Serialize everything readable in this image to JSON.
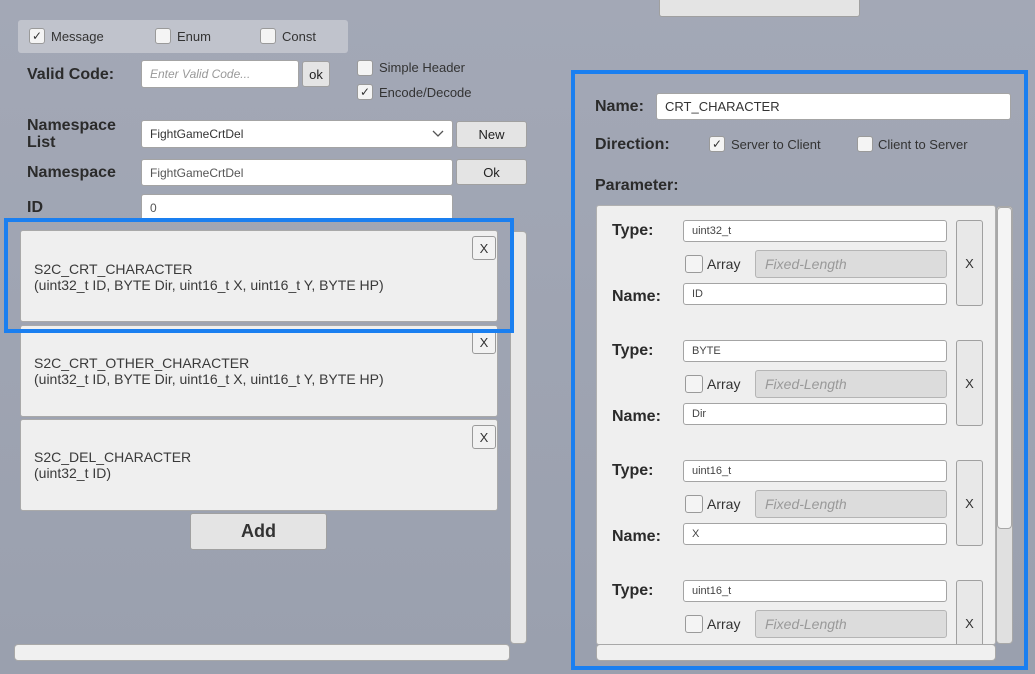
{
  "top_button": {
    "label": ""
  },
  "options": [
    {
      "label": "Message",
      "checked": true
    },
    {
      "label": "Enum",
      "checked": false
    },
    {
      "label": "Const",
      "checked": false
    }
  ],
  "valid_code": {
    "label": "Valid Code:",
    "placeholder": "Enter Valid Code...",
    "ok_label": "ok"
  },
  "flags": [
    {
      "label": "Simple Header",
      "checked": false
    },
    {
      "label": "Encode/Decode",
      "checked": true
    }
  ],
  "namespace_list": {
    "label": "Namespace List",
    "selected": "FightGameCrtDel",
    "new_label": "New"
  },
  "namespace": {
    "label": "Namespace",
    "value": "FightGameCrtDel",
    "ok_label": "Ok"
  },
  "id_field": {
    "label": "ID",
    "value": "0"
  },
  "messages": [
    {
      "name": "S2C_CRT_CHARACTER",
      "signature": "(uint32_t ID, BYTE Dir, uint16_t X, uint16_t Y, BYTE HP)",
      "close": "X"
    },
    {
      "name": "S2C_CRT_OTHER_CHARACTER",
      "signature": "(uint32_t ID, BYTE Dir, uint16_t X, uint16_t Y, BYTE HP)",
      "close": "X"
    },
    {
      "name": "S2C_DEL_CHARACTER",
      "signature": "(uint32_t ID)",
      "close": "X"
    }
  ],
  "add_label": "Add",
  "detail": {
    "name_label": "Name:",
    "name_value": "CRT_CHARACTER",
    "direction_label": "Direction:",
    "directions": [
      {
        "label": "Server to Client",
        "checked": true
      },
      {
        "label": "Client to Server",
        "checked": false
      }
    ],
    "parameter_label": "Parameter:",
    "type_label": "Type:",
    "pname_label": "Name:",
    "array_label": "Array",
    "fixed_placeholder": "Fixed-Length",
    "remove_label": "X",
    "parameters": [
      {
        "type": "uint32_t",
        "name": "ID",
        "array": false
      },
      {
        "type": "BYTE",
        "name": "Dir",
        "array": false
      },
      {
        "type": "uint16_t",
        "name": "X",
        "array": false
      },
      {
        "type": "uint16_t",
        "name": "",
        "array": false
      }
    ]
  },
  "colors": {
    "selection": "#1a7ff0",
    "background": "#a0a5b3"
  }
}
